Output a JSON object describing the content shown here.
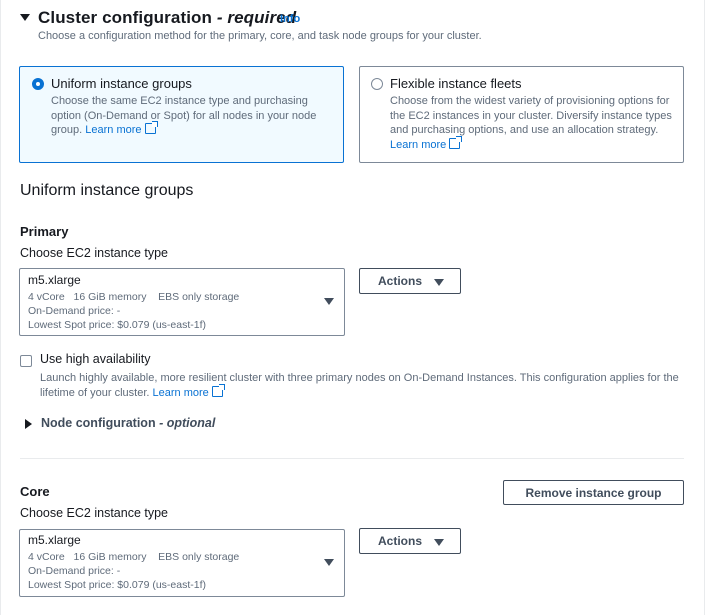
{
  "section": {
    "title": "Cluster configuration",
    "title_suffix": "- required",
    "info_link": "Info",
    "description": "Choose a configuration method for the primary, core, and task node groups for your cluster."
  },
  "options": [
    {
      "title": "Uniform instance groups",
      "description": "Choose the same EC2 instance type and purchasing option (On-Demand or Spot) for all nodes in your node group.",
      "link": "Learn more",
      "selected": true
    },
    {
      "title": "Flexible instance fleets",
      "description": "Choose from the widest variety of provisioning options for the EC2 instances in your cluster. Diversify instance types and purchasing options, and use an allocation strategy.",
      "link": "Learn more",
      "selected": false
    }
  ],
  "uniform_heading": "Uniform instance groups",
  "primary": {
    "heading": "Primary",
    "field_label": "Choose EC2 instance type",
    "instance": {
      "name": "m5.xlarge",
      "vcore": "4 vCore",
      "memory": "16 GiB memory",
      "storage": "EBS only storage",
      "ondemand": "On-Demand price: -",
      "spot": "Lowest Spot price: $0.079 (us-east-1f)"
    },
    "actions_label": "Actions",
    "ha_label": "Use high availability",
    "ha_desc_line1": "Launch highly available, more resilient cluster with three primary nodes on On-Demand Instances. This configuration applies for the",
    "ha_desc_line2": "lifetime of your cluster.",
    "ha_link": "Learn more",
    "ha_checked": false,
    "node_config": "Node configuration",
    "node_config_suffix": "- optional"
  },
  "core": {
    "heading": "Core",
    "remove_label": "Remove instance group",
    "field_label": "Choose EC2 instance type",
    "instance": {
      "name": "m5.xlarge",
      "vcore": "4 vCore",
      "memory": "16 GiB memory",
      "storage": "EBS only storage",
      "ondemand": "On-Demand price: -",
      "spot": "Lowest Spot price: $0.079 (us-east-1f)"
    },
    "actions_label": "Actions"
  },
  "colors": {
    "accent": "#0972d3",
    "text": "#16191f",
    "muted": "#5f6b7a",
    "border": "#7d8998"
  }
}
